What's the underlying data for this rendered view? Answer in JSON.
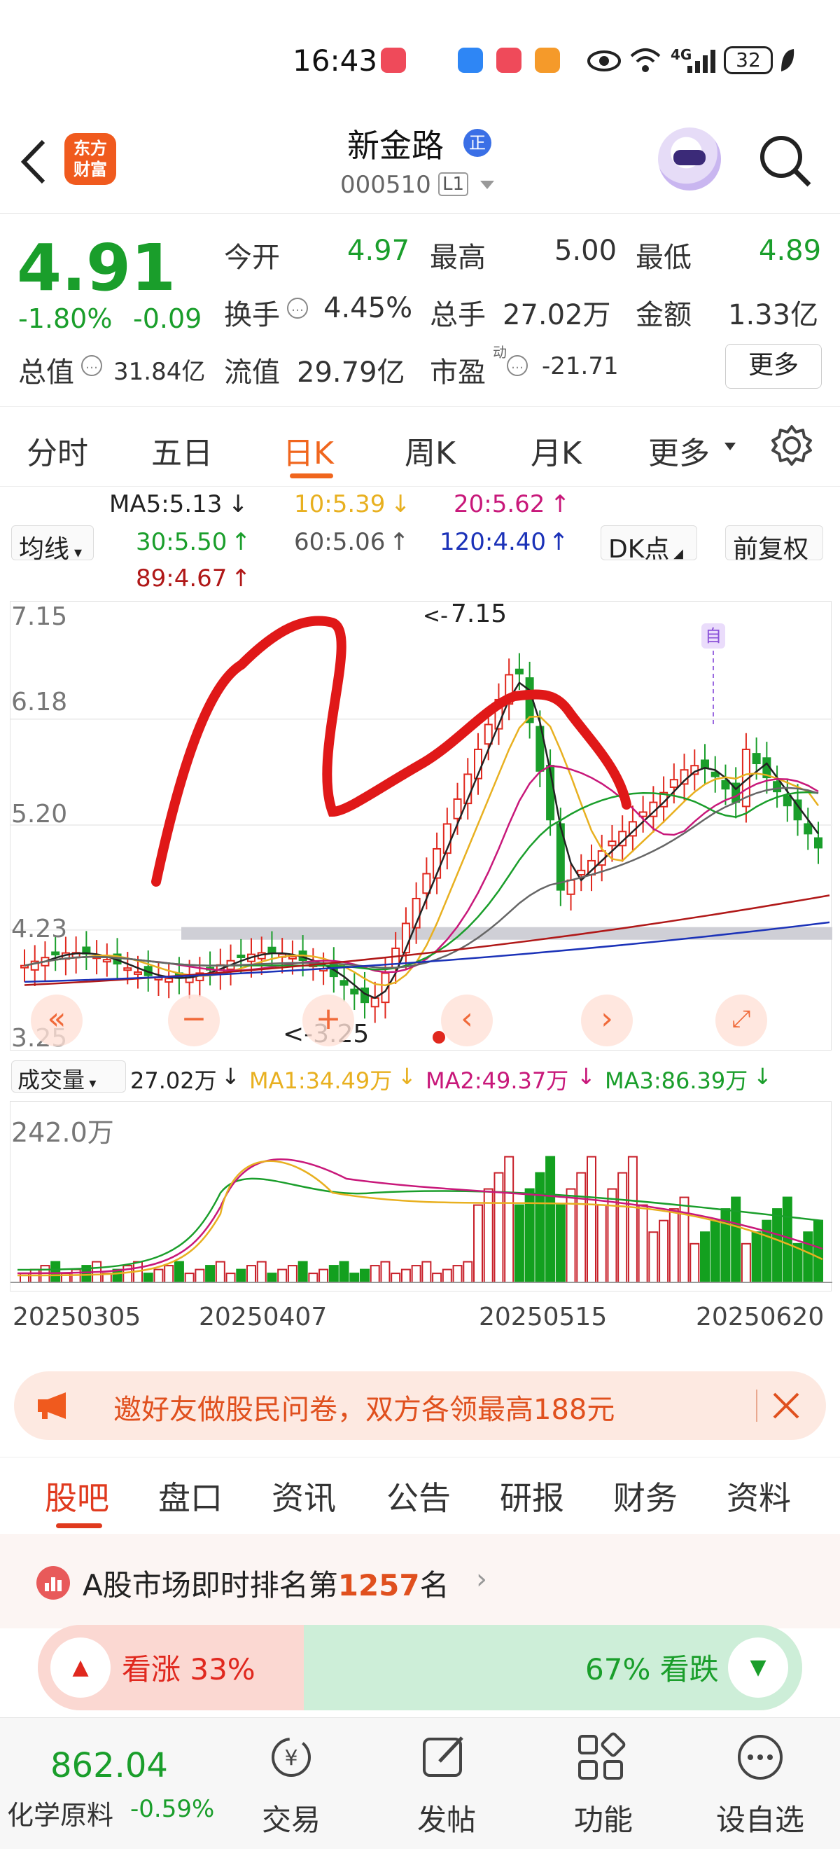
{
  "status_bar": {
    "time": "16:43",
    "network": "4G",
    "battery": "32"
  },
  "header": {
    "logo_text_1": "东方",
    "logo_text_2": "财富",
    "stock_name": "新金路",
    "badge": "正",
    "stock_code": "000510",
    "market_level": "L1"
  },
  "quote": {
    "price": "4.91",
    "change_pct": "-1.80%",
    "change_abs": "-0.09",
    "open_label": "今开",
    "open": "4.97",
    "high_label": "最高",
    "high": "5.00",
    "low_label": "最低",
    "low": "4.89",
    "turnover_label": "换手",
    "turnover": "4.45%",
    "volume_label": "总手",
    "volume": "27.02万",
    "amount_label": "金额",
    "amount": "1.33亿",
    "mktcap_label": "总值",
    "mktcap": "31.84亿",
    "float_label": "流值",
    "float_cap": "29.79亿",
    "pe_label": "市盈",
    "pe_sup": "动",
    "pe": "-21.71",
    "more_button": "更多"
  },
  "kline_tabs": [
    {
      "label": "分时"
    },
    {
      "label": "五日"
    },
    {
      "label": "日K"
    },
    {
      "label": "周K"
    },
    {
      "label": "月K"
    },
    {
      "label": "更多"
    }
  ],
  "ma_legend": {
    "selector": "均线",
    "ma5": "MA5:5.13",
    "ma10": "10:5.39",
    "ma20": "20:5.62",
    "ma30": "30:5.50",
    "ma60": "60:5.06",
    "ma120": "120:4.40",
    "ma89": "89:4.67",
    "dk_button": "DK点",
    "adjust_button": "前复权"
  },
  "chart": {
    "y_labels": [
      "7.15",
      "6.18",
      "5.20",
      "4.23",
      "3.25"
    ],
    "max_label": "7.15",
    "min_label": "<-3.25",
    "marker_text": "自"
  },
  "volume": {
    "selector": "成交量",
    "current": "27.02万",
    "ma1": "MA1:34.49万",
    "ma2": "MA2:49.37万",
    "ma3": "MA3:86.39万",
    "y_label": "242.0万",
    "dates": [
      "20250305",
      "20250407",
      "20250515",
      "20250620"
    ]
  },
  "chart_data": {
    "type": "candlestick",
    "price_range": [
      3.25,
      7.15
    ],
    "volume_max": "242.0万",
    "last_close": 4.91,
    "ma": {
      "MA5": 5.13,
      "MA10": 5.39,
      "MA20": 5.62,
      "MA30": 5.5,
      "MA60": 5.06,
      "MA120": 4.4,
      "MA89": 4.67
    },
    "volume_ma": {
      "MA1": "34.49万",
      "MA2": "49.37万",
      "MA3": "86.39万"
    },
    "x_ticks": [
      "20250305",
      "20250407",
      "20250515",
      "20250620"
    ]
  },
  "banner": {
    "text": "邀好友做股民问卷，双方各领最高188元"
  },
  "bottom_tabs": [
    {
      "label": "股吧"
    },
    {
      "label": "盘口"
    },
    {
      "label": "资讯"
    },
    {
      "label": "公告"
    },
    {
      "label": "研报"
    },
    {
      "label": "财务"
    },
    {
      "label": "资料"
    }
  ],
  "rank": {
    "prefix": "A股市场即时排名第",
    "number": "1257",
    "suffix": "名"
  },
  "sentiment": {
    "up_label": "看涨 33%",
    "down_label": "67% 看跌",
    "up_pct": 33
  },
  "bottom_bar": {
    "index_value": "862.04",
    "index_name": "化学原料",
    "index_change": "-0.59%",
    "nav": [
      {
        "label": "交易"
      },
      {
        "label": "发帖"
      },
      {
        "label": "功能"
      },
      {
        "label": "设自选"
      }
    ]
  }
}
